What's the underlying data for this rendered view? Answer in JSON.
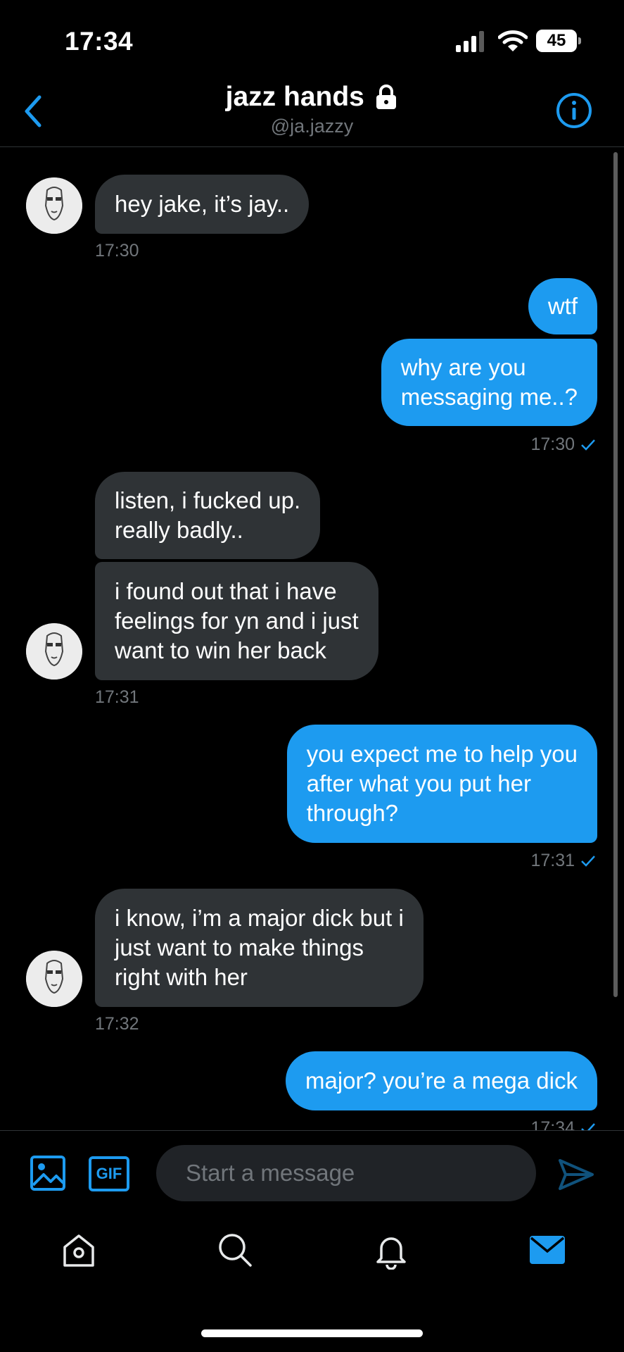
{
  "status_bar": {
    "time": "17:34",
    "battery": "45"
  },
  "header": {
    "title": "jazz hands",
    "handle": "@ja.jazzy"
  },
  "messages": [
    {
      "from": "them",
      "lines": [
        "hey jake, it’s jay.."
      ],
      "time": "17:30"
    },
    {
      "from": "me",
      "lines": [
        "wtf"
      ]
    },
    {
      "from": "me",
      "lines": [
        "why are you",
        "messaging me..?"
      ],
      "time": "17:30"
    },
    {
      "from": "them",
      "lines": [
        "listen, i fucked up.",
        "really badly.."
      ]
    },
    {
      "from": "them",
      "lines": [
        "i found out that i have",
        "feelings for yn and i just",
        "want to win her back"
      ],
      "time": "17:31"
    },
    {
      "from": "me",
      "lines": [
        "you expect me to help you",
        "after what you put her",
        "through?"
      ],
      "time": "17:31"
    },
    {
      "from": "them",
      "lines": [
        "i know, i’m a major dick but i",
        "just want to make things",
        "right with her"
      ],
      "time": "17:32"
    },
    {
      "from": "me",
      "lines": [
        "major? you’re a mega dick"
      ],
      "time": "17:34"
    }
  ],
  "composer": {
    "gif_label": "GIF",
    "placeholder": "Start a message"
  },
  "colors": {
    "accent": "#1d9bf0",
    "received_bubble": "#2f3336",
    "muted": "#71767b",
    "background": "#000000"
  },
  "icons": {
    "back": "chevron-left-icon",
    "lock": "lock-icon",
    "info": "info-icon",
    "media": "image-icon",
    "gif": "gif-icon",
    "send": "send-icon",
    "tabs": [
      "home-icon",
      "search-icon",
      "bell-icon",
      "mail-icon"
    ]
  }
}
